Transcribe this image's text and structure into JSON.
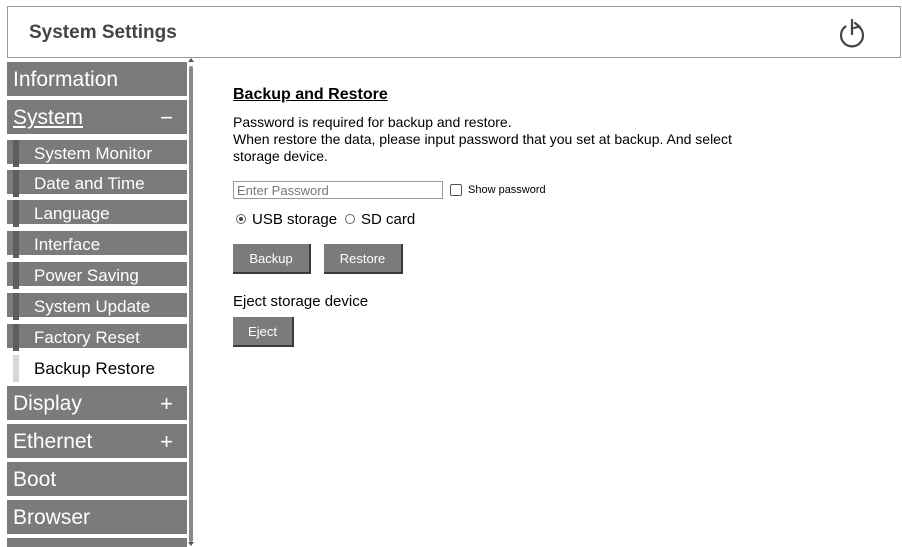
{
  "header": {
    "title": "System Settings",
    "power_icon": "power-icon"
  },
  "sidebar": {
    "items": [
      {
        "label": "Information",
        "type": "top",
        "sign": ""
      },
      {
        "label": "System",
        "type": "top",
        "sign": "−",
        "expanded": true
      },
      {
        "label": "System Monitor",
        "type": "sub"
      },
      {
        "label": "Date and Time",
        "type": "sub"
      },
      {
        "label": "Language",
        "type": "sub"
      },
      {
        "label": "Interface",
        "type": "sub"
      },
      {
        "label": "Power Saving",
        "type": "sub"
      },
      {
        "label": "System Update",
        "type": "sub"
      },
      {
        "label": "Factory Reset",
        "type": "sub"
      },
      {
        "label": "Backup Restore",
        "type": "sub",
        "active": true
      },
      {
        "label": "Display",
        "type": "top",
        "sign": "+"
      },
      {
        "label": "Ethernet",
        "type": "top",
        "sign": "+"
      },
      {
        "label": "Boot",
        "type": "top",
        "sign": ""
      },
      {
        "label": "Browser",
        "type": "top",
        "sign": ""
      }
    ]
  },
  "main": {
    "title": "Backup and Restore",
    "desc_line1": "Password is required for backup and restore.",
    "desc_line2": "When restore the data, please input password that you set at backup. And select storage device.",
    "password_value": "",
    "password_placeholder": "Enter Password",
    "show_password_label": "Show password",
    "storage_options": [
      {
        "label": "USB storage",
        "selected": true
      },
      {
        "label": "SD card",
        "selected": false
      }
    ],
    "backup_label": "Backup",
    "restore_label": "Restore",
    "eject_text": "Eject storage device",
    "eject_label": "Eject"
  },
  "colors": {
    "nav_bg": "#7b7b7b",
    "nav_marker": "#5e5e5e",
    "active_bg": "#ffffff",
    "button_bg": "#7b7b7b",
    "title_text": "#444444"
  }
}
